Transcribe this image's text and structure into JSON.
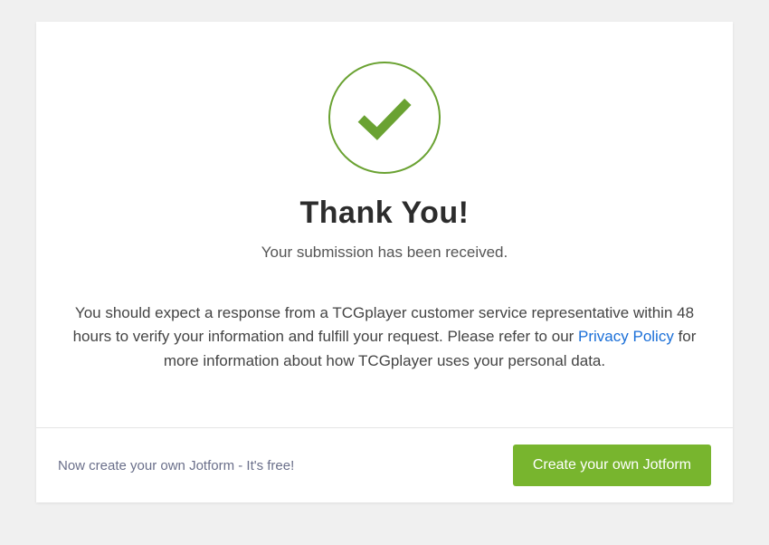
{
  "main": {
    "title": "Thank You!",
    "subtitle": "Your submission has been received.",
    "body_pre": "You should expect a response from a TCGplayer customer service representative within 48 hours to verify your information and fulfill your request. Please refer to our ",
    "body_link": "Privacy Policy",
    "body_post": " for more information about how TCGplayer uses your personal data."
  },
  "footer": {
    "prompt_text": "Now create your own Jotform - It's free!",
    "cta_label": "Create your own Jotform"
  },
  "colors": {
    "accent_green": "#78b52e",
    "link_blue": "#1a6fd8"
  }
}
